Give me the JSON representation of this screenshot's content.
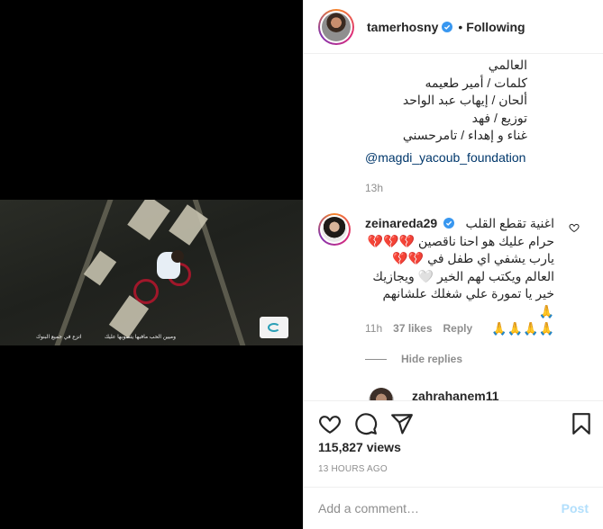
{
  "header": {
    "username": "tamerhosny",
    "separator": "•",
    "follow_status": "Following"
  },
  "video": {
    "caption_left": "اتزع في جميع البنوك",
    "caption_right": "وميين الحب مافيها يتصوبها عليك"
  },
  "post_caption": {
    "lines": [
      "العالمي",
      "كلمات / أمير طعيمه",
      "ألحان / إيهاب عبد الواحد",
      "توزيع / فهد",
      "غناء و إهداء / تامرحسني"
    ],
    "mention": "@magdi_yacoub_foundation",
    "time": "13h"
  },
  "comment": {
    "username": "zeinareda29",
    "lines": [
      "اغنية تقطع القلب",
      "حرام عليك هو احنا ناقصين 💔💔💔",
      "يارب يشفي اي طفل في 💔💔",
      "العالم ويكتب لهم الخير 🤍 ويجازيك",
      "خير يا تمورة علي شغلك علشانهم 🙏",
      "🙏🙏🙏🙏"
    ],
    "time": "11h",
    "likes": "37 likes",
    "reply": "Reply",
    "hide_replies": "Hide replies"
  },
  "reply": {
    "username": "zahrahanem11"
  },
  "stats": {
    "views": "115,827 views",
    "ago": "13 HOURS AGO"
  },
  "comment_box": {
    "placeholder": "Add a comment…",
    "post_label": "Post"
  },
  "colors": {
    "verified": "#3897f0",
    "link": "#00376b",
    "muted": "#8e8e8e",
    "post_disabled": "#b2dffc"
  }
}
